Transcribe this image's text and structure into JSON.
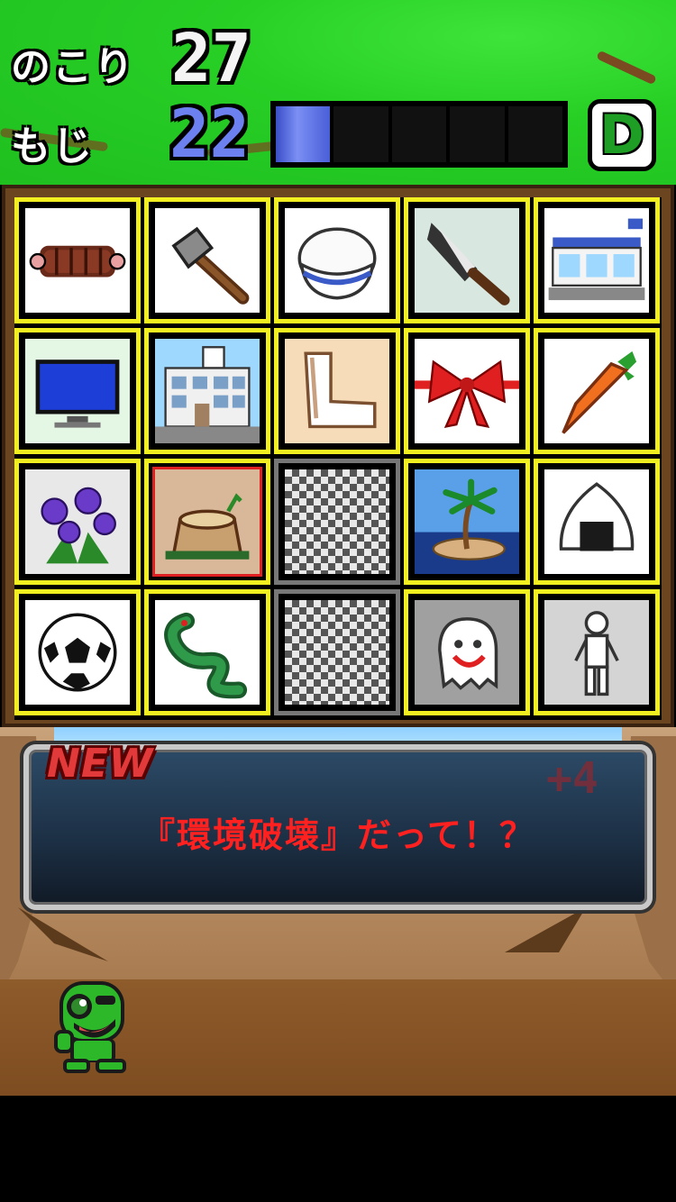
{
  "hud": {
    "remaining_label": "のこり",
    "remaining_value": "27",
    "chars_label": "もじ",
    "chars_value": "22",
    "meter": {
      "segments_total": 5,
      "segments_filled": 1
    },
    "grade": "D"
  },
  "board": {
    "tiles": [
      {
        "icon": "meat-icon",
        "bg": "#ffffff"
      },
      {
        "icon": "axe-icon",
        "bg": "#ffffff"
      },
      {
        "icon": "rice-bowl-icon",
        "bg": "#ffffff"
      },
      {
        "icon": "kitchen-knife-icon",
        "bg": "#d8e8e0"
      },
      {
        "icon": "convenience-store-icon",
        "bg": "#ffffff"
      },
      {
        "icon": "television-icon",
        "bg": "#e4f6e4"
      },
      {
        "icon": "school-building-icon",
        "bg": "#dfeef8"
      },
      {
        "icon": "bent-leg-icon",
        "bg": "#f6dcb8"
      },
      {
        "icon": "red-ribbon-icon",
        "bg": "#ffffff"
      },
      {
        "icon": "carrot-icon",
        "bg": "#ffffff"
      },
      {
        "icon": "purple-flower-icon",
        "bg": "#e8e8e8"
      },
      {
        "icon": "tree-stump-icon",
        "bg": "#d8b898"
      },
      {
        "icon": "hidden-tile-icon",
        "bg": "checker"
      },
      {
        "icon": "palm-island-icon",
        "bg": "#3a7ac8"
      },
      {
        "icon": "onigiri-icon",
        "bg": "#ffffff"
      },
      {
        "icon": "soccer-ball-icon",
        "bg": "#ffffff"
      },
      {
        "icon": "snake-icon",
        "bg": "#ffffff"
      },
      {
        "icon": "hidden-tile-icon",
        "bg": "checker"
      },
      {
        "icon": "ghost-icon",
        "bg": "#a0a0a0"
      },
      {
        "icon": "stick-figure-icon",
        "bg": "#d4d4d4"
      }
    ],
    "selected_index": 11
  },
  "message": {
    "badge": "NEW",
    "bonus": "+4",
    "text": "『環境破壊』だって！？"
  },
  "colors": {
    "hud_green": "#27cf25",
    "tile_border": "#f2ef20",
    "selected_border": "#e02020",
    "message_text": "#ff2020",
    "meter_blue": "#5b6fe8"
  }
}
